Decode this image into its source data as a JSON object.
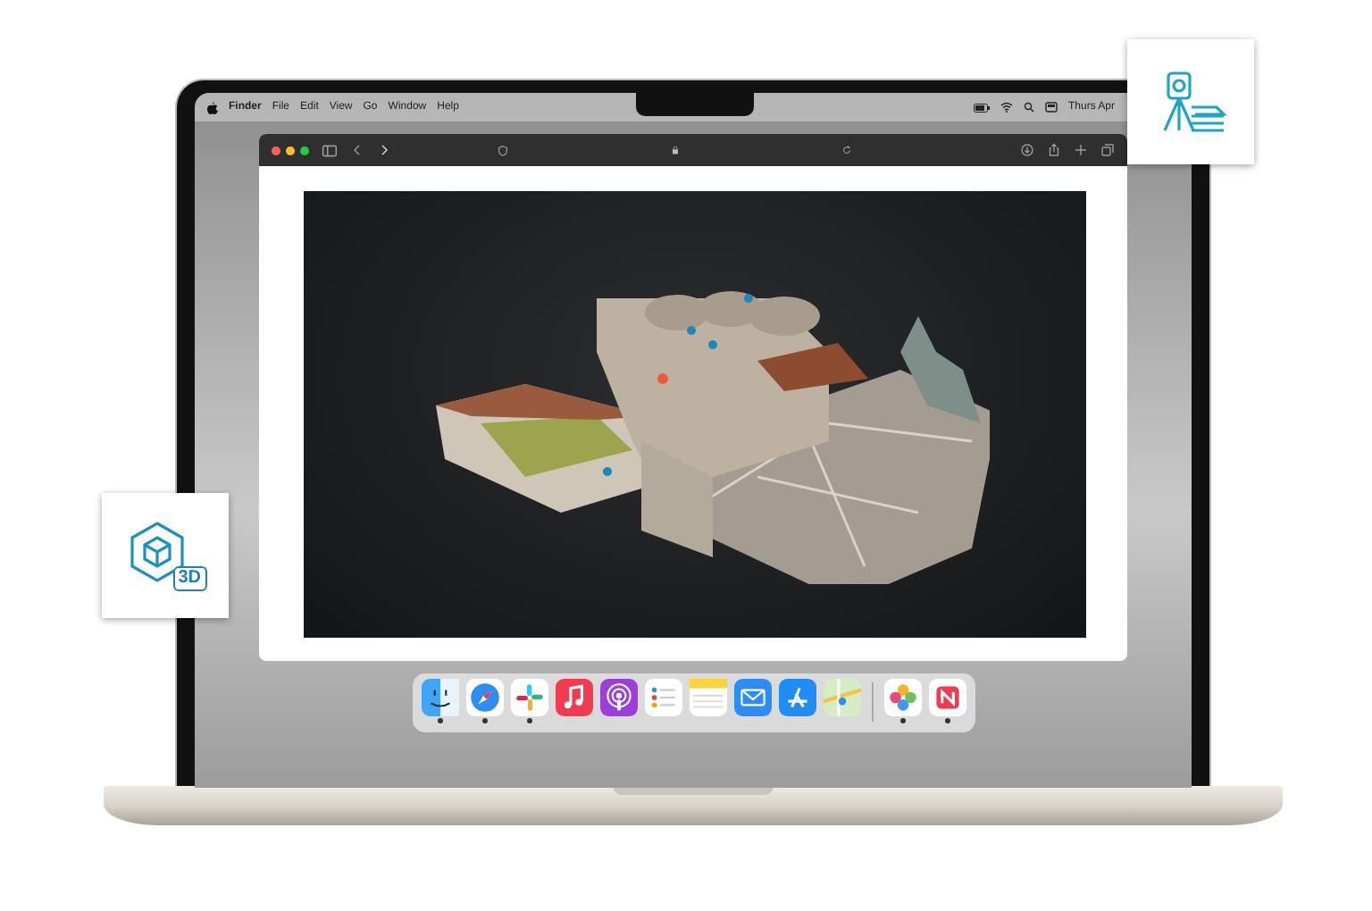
{
  "menu_bar": {
    "app_name": "Finder",
    "items": [
      "File",
      "Edit",
      "View",
      "Go",
      "Window",
      "Help"
    ],
    "clock": "Thurs Apr"
  },
  "dock": [
    {
      "kind": "finder",
      "running": true
    },
    {
      "kind": "safari",
      "running": true
    },
    {
      "kind": "slack",
      "running": true
    },
    {
      "kind": "music",
      "running": false
    },
    {
      "kind": "podcasts",
      "running": false
    },
    {
      "kind": "reminders",
      "running": false
    },
    {
      "kind": "notes",
      "running": false
    },
    {
      "kind": "mail",
      "running": false
    },
    {
      "kind": "appstore",
      "running": false
    },
    {
      "kind": "maps",
      "running": false
    },
    {
      "kind": "separator"
    },
    {
      "kind": "photos",
      "running": true
    },
    {
      "kind": "news",
      "running": true
    }
  ],
  "feature_cards": [
    {
      "kind": "surveying"
    },
    {
      "kind": "model_3d",
      "label": "3D"
    }
  ]
}
